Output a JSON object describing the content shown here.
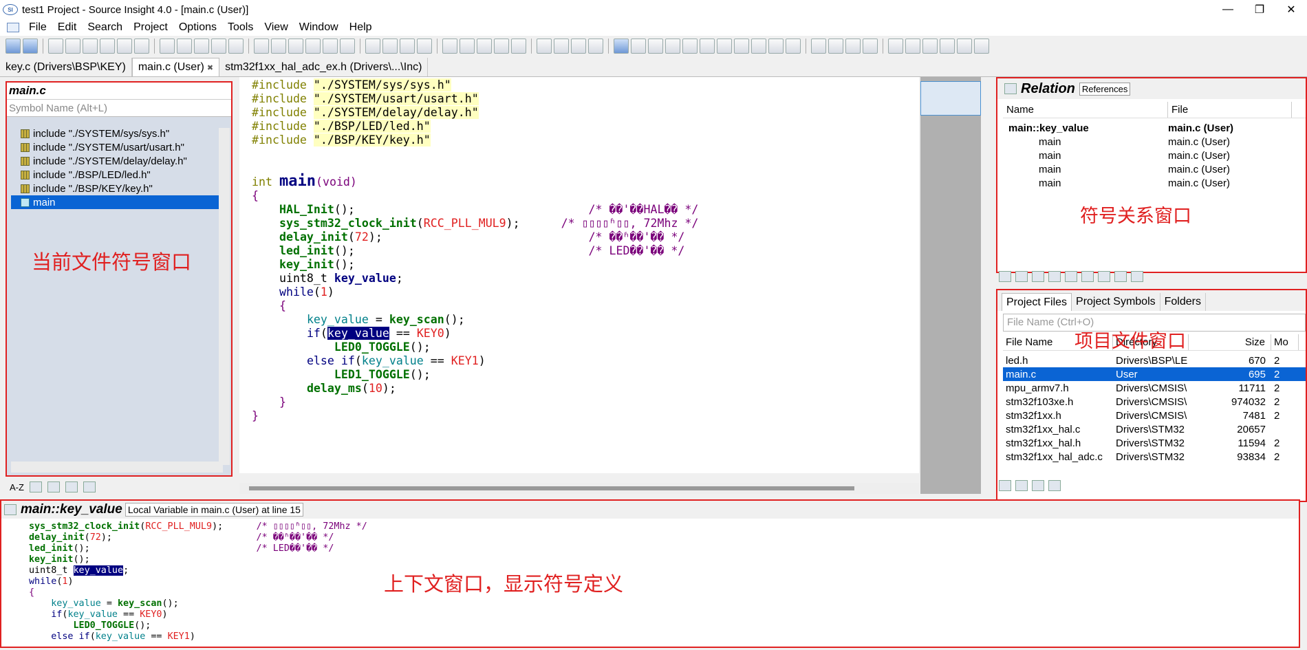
{
  "window": {
    "title": "test1 Project - Source Insight 4.0 - [main.c (User)]",
    "minimize": "—",
    "maximize": "❐",
    "close": "✕"
  },
  "menu": [
    "File",
    "Edit",
    "Search",
    "Project",
    "Options",
    "Tools",
    "View",
    "Window",
    "Help"
  ],
  "tabs": [
    {
      "label": "key.c (Drivers\\BSP\\KEY)"
    },
    {
      "label": "main.c (User)",
      "close": "✖"
    },
    {
      "label": "stm32f1xx_hal_adc_ex.h (Drivers\\...\\Inc)"
    }
  ],
  "symbol_window": {
    "title": "main.c",
    "search_placeholder": "Symbol Name (Alt+L)",
    "items": [
      "include \"./SYSTEM/sys/sys.h\"",
      "include \"./SYSTEM/usart/usart.h\"",
      "include \"./SYSTEM/delay/delay.h\"",
      "include \"./BSP/LED/led.h\"",
      "include \"./BSP/KEY/key.h\"",
      "main"
    ],
    "selected": "main",
    "sort_label": "A-Z",
    "annotation": "当前文件符号窗口"
  },
  "relation_window": {
    "title": "Relation",
    "tab": "References",
    "columns": [
      "Name",
      "File"
    ],
    "rows": [
      {
        "name": "main::key_value",
        "file": "main.c (User)"
      },
      {
        "name": "main",
        "file": "main.c (User)"
      },
      {
        "name": "main",
        "file": "main.c (User)"
      },
      {
        "name": "main",
        "file": "main.c (User)"
      },
      {
        "name": "main",
        "file": "main.c (User)"
      }
    ],
    "annotation": "符号关系窗口"
  },
  "project_window": {
    "tabs": [
      "Project Files",
      "Project Symbols",
      "Folders"
    ],
    "filter_placeholder": "File Name (Ctrl+O)",
    "columns": [
      "File Name",
      "Directory",
      "Size",
      "Mo"
    ],
    "files": [
      {
        "name": "led.h",
        "dir": "Drivers\\BSP\\LE",
        "size": "670",
        "mod": "2"
      },
      {
        "name": "main.c",
        "dir": "User",
        "size": "695",
        "mod": "2"
      },
      {
        "name": "mpu_armv7.h",
        "dir": "Drivers\\CMSIS\\",
        "size": "11711",
        "mod": "2"
      },
      {
        "name": "stm32f103xe.h",
        "dir": "Drivers\\CMSIS\\",
        "size": "974032",
        "mod": "2"
      },
      {
        "name": "stm32f1xx.h",
        "dir": "Drivers\\CMSIS\\",
        "size": "7481",
        "mod": "2"
      },
      {
        "name": "stm32f1xx_hal.c",
        "dir": "Drivers\\STM32",
        "size": "20657",
        "mod": ""
      },
      {
        "name": "stm32f1xx_hal.h",
        "dir": "Drivers\\STM32",
        "size": "11594",
        "mod": "2"
      },
      {
        "name": "stm32f1xx_hal_adc.c",
        "dir": "Drivers\\STM32",
        "size": "93834",
        "mod": "2"
      }
    ],
    "selected": "main.c",
    "annotation": "项目文件窗口"
  },
  "context_window": {
    "title": "main::key_value",
    "info": "Local Variable in main.c (User) at line 15",
    "annotation": "上下文窗口，显示符号定义"
  },
  "editor": {
    "includes": [
      "\"./SYSTEM/sys/sys.h\"",
      "\"./SYSTEM/usart/usart.h\"",
      "\"./SYSTEM/delay/delay.h\"",
      "\"./BSP/LED/led.h\"",
      "\"./BSP/KEY/key.h\""
    ]
  }
}
